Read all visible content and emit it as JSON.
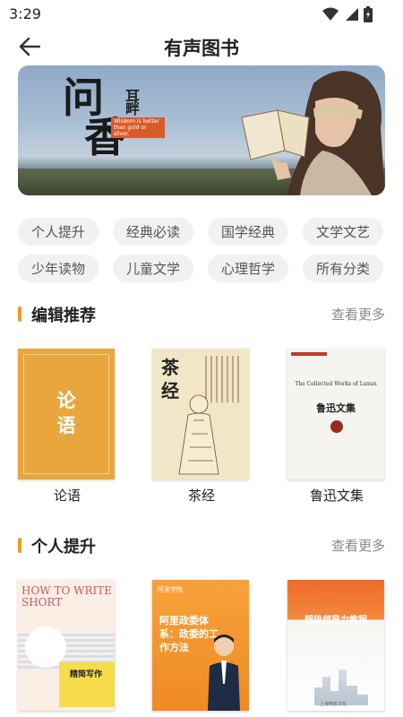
{
  "status_bar": {
    "time": "3:29"
  },
  "header": {
    "title": "有声图书"
  },
  "banner": {
    "title_line1": "问",
    "title_line2": "香",
    "side_text": "耳畔",
    "caption": "Wisdom is better than gold or silver."
  },
  "tags": [
    "个人提升",
    "经典必读",
    "国学经典",
    "文学文艺",
    "少年读物",
    "儿童文学",
    "心理哲学",
    "所有分类"
  ],
  "sections": [
    {
      "title": "编辑推荐",
      "more": "查看更多",
      "books": [
        {
          "name": "论语",
          "cover_text": "论\n语"
        },
        {
          "name": "茶经",
          "cover_text": "茶\n经"
        },
        {
          "name": "鲁迅文集",
          "cover_en": "The Collected Works of Luxun",
          "cover_cn": "鲁迅文集"
        }
      ]
    },
    {
      "title": "个人提升",
      "more": "查看更多",
      "books": [
        {
          "cover_en": "HOW TO WRITE SHORT",
          "cover_cn": "精简写作"
        },
        {
          "cover_logo": "阿里学院",
          "cover_headline": "阿里政委体系：政委的工作方法"
        },
        {
          "cover_title": "超级领导力教程",
          "cover_pub": "上海电影文化"
        }
      ]
    }
  ],
  "colors": {
    "accent": "#f39a1e",
    "tag_bg": "#f1f1f1"
  }
}
